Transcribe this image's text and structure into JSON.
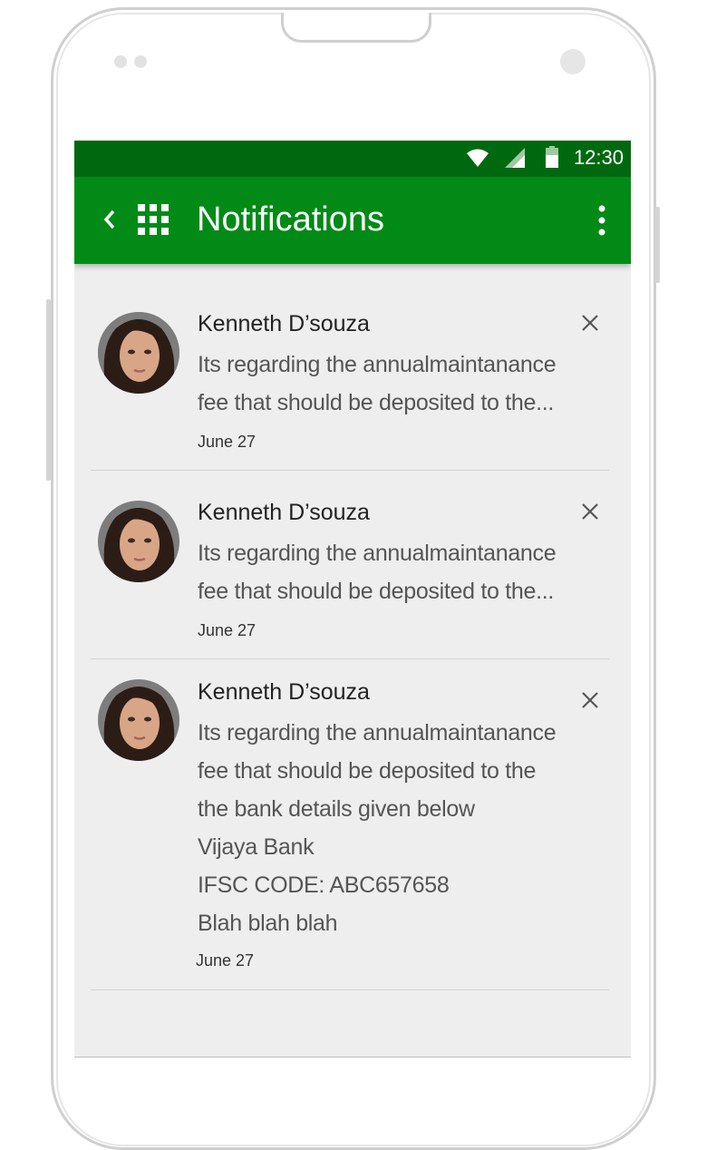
{
  "status_bar": {
    "time": "12:30"
  },
  "app_bar": {
    "title": "Notifications"
  },
  "colors": {
    "status_bar": "#00690f",
    "app_bar": "#028a17",
    "background": "#eeeeee"
  },
  "notifications": [
    {
      "sender": "Kenneth D’souza",
      "lines": [
        "Its regarding the annualmaintanance",
        "fee that should be deposited to the..."
      ],
      "date": "June 27"
    },
    {
      "sender": "Kenneth D’souza",
      "lines": [
        "Its regarding the annualmaintanance",
        "fee that should be deposited to the..."
      ],
      "date": "June 27"
    },
    {
      "sender": "Kenneth D’souza",
      "lines": [
        "Its regarding the annualmaintanance",
        "fee that should be deposited to the",
        "the bank details given below",
        "Vijaya Bank",
        "IFSC CODE: ABC657658",
        "Blah blah blah"
      ],
      "date": "June 27"
    }
  ],
  "icons": {
    "back": "chevron-left-icon",
    "apps": "apps-grid-icon",
    "more": "more-vert-icon",
    "close": "close-icon",
    "wifi": "wifi-icon",
    "signal": "signal-icon",
    "battery": "battery-icon"
  }
}
